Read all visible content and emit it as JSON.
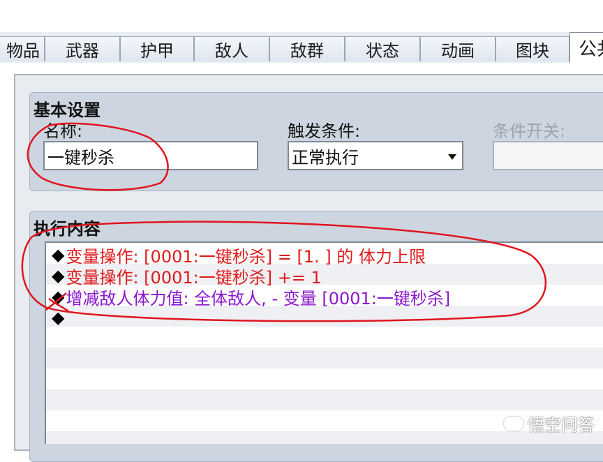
{
  "tabs": [
    {
      "label": "物品"
    },
    {
      "label": "武器"
    },
    {
      "label": "护甲"
    },
    {
      "label": "敌人"
    },
    {
      "label": "敌群"
    },
    {
      "label": "状态"
    },
    {
      "label": "动画"
    },
    {
      "label": "图块"
    },
    {
      "label": "公共"
    }
  ],
  "basic": {
    "title": "基本设置",
    "name_label": "名称:",
    "name_value": "一键秒杀",
    "trigger_label": "触发条件:",
    "trigger_value": "正常执行",
    "switch_label": "条件开关:",
    "switch_value": ""
  },
  "exec": {
    "title": "执行内容",
    "commands": [
      {
        "text": "变量操作: [0001:一键秒杀] = [1. ] 的 体力上限",
        "color": "#e01a1a"
      },
      {
        "text": "变量操作: [0001:一键秒杀] += 1",
        "color": "#e01a1a"
      },
      {
        "text": "增减敌人体力值: 全体敌人, - 变量 [0001:一键秒杀]",
        "color": "#8b17cc"
      },
      {
        "text": "",
        "color": "#000000"
      }
    ]
  },
  "watermark": "悟空问答",
  "colors": {
    "annotation": "#e0141e",
    "panel": "#cdd6e0",
    "command_red": "#e01a1a",
    "command_purple": "#8b17cc"
  }
}
